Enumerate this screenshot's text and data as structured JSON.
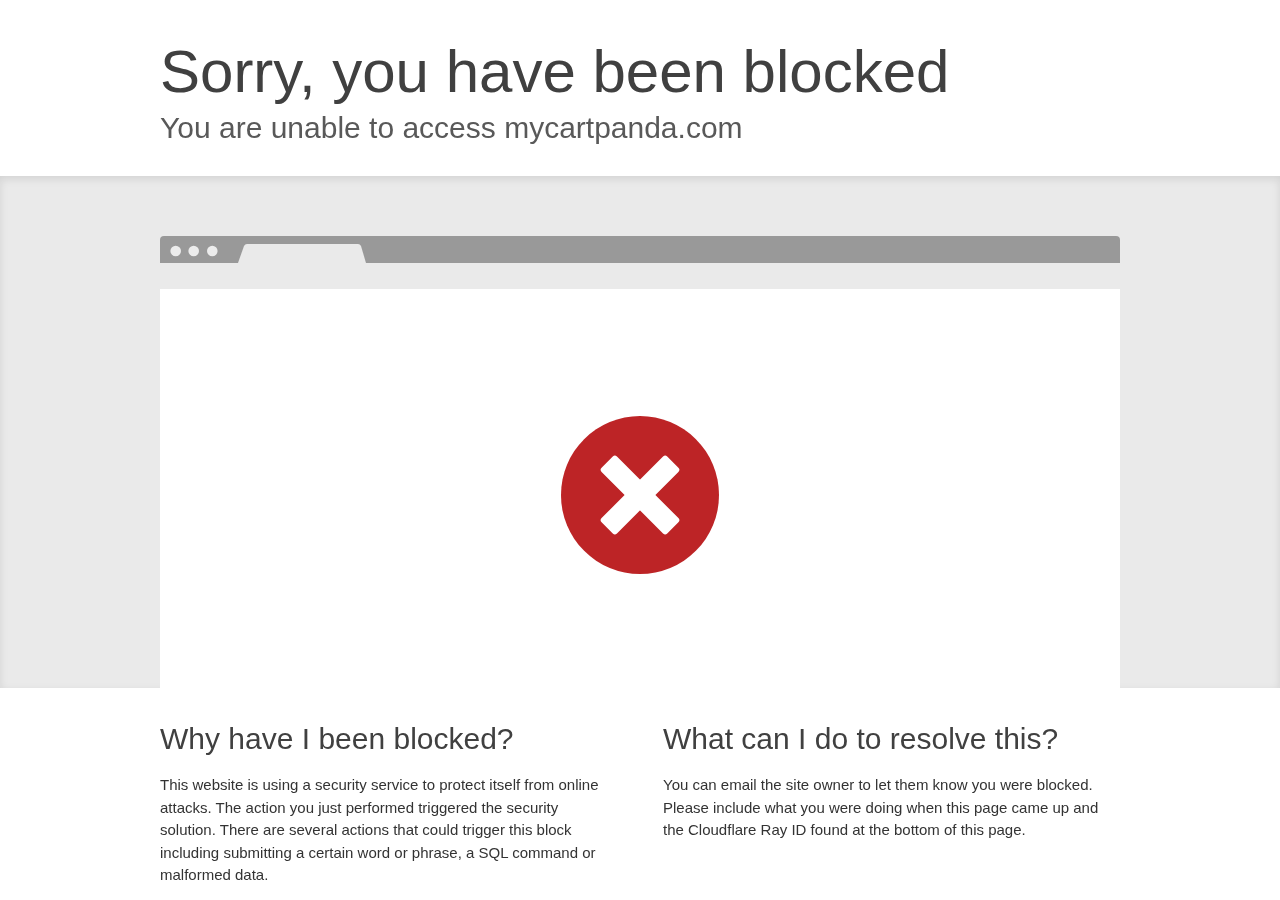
{
  "header": {
    "title": "Sorry, you have been blocked",
    "subtitle": "You are unable to access mycartpanda.com"
  },
  "sections": [
    {
      "heading": "Why have I been blocked?",
      "body": "This website is using a security service to protect itself from online attacks. The action you just performed triggered the security solution. There are several actions that could trigger this block including submitting a certain word or phrase, a SQL command or malformed data."
    },
    {
      "heading": "What can I do to resolve this?",
      "body": "You can email the site owner to let them know you were blocked. Please include what you were doing when this page came up and the Cloudflare Ray ID found at the bottom of this page."
    }
  ]
}
